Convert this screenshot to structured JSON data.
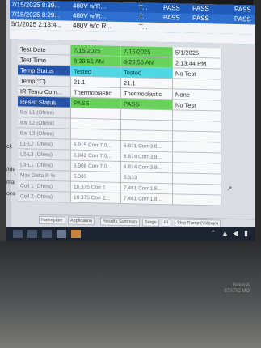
{
  "history": {
    "rows": [
      {
        "datetime": "7/15/2025 8:39...",
        "model": "480V w/R...",
        "col3": "T...",
        "status1": "PASS",
        "status2": "PASS",
        "status3": "PASS"
      },
      {
        "datetime": "7/15/2025 8:29...",
        "model": "480V w/R...",
        "col3": "T...",
        "status1": "PASS",
        "status2": "PASS",
        "status3": "PASS"
      },
      {
        "datetime": "5/1/2025 2:13:4...",
        "model": "480V w/o R...",
        "col3": "T...",
        "status1": "",
        "status2": "",
        "status3": ""
      }
    ]
  },
  "table": {
    "rows": [
      {
        "label": "Test Date",
        "v1": "7/15/2025",
        "v2": "7/15/2025",
        "v3": "5/1/2025"
      },
      {
        "label": "Test Time",
        "v1": "8:39:51 AM",
        "v2": "8:29:56 AM",
        "v3": "2:13:44 PM"
      },
      {
        "label": "Temp Status",
        "v1": "Tested",
        "v2": "Tested",
        "v3": "No Test"
      },
      {
        "label": "Temp(°C)",
        "v1": "21.1",
        "v2": "21.1",
        "v3": ""
      },
      {
        "label": "IR Temp Com...",
        "v1": "Thermoplastic",
        "v2": "Thermoplastic",
        "v3": "None"
      },
      {
        "label": "Resist Status",
        "v1": "PASS",
        "v2": "PASS",
        "v3": "No Test"
      },
      {
        "label": "Bal L1 (Ohms)",
        "v1": "",
        "v2": "",
        "v3": ""
      },
      {
        "label": "Bal L2 (Ohms)",
        "v1": "",
        "v2": "",
        "v3": ""
      },
      {
        "label": "Bal L3 (Ohms)",
        "v1": "",
        "v2": "",
        "v3": ""
      },
      {
        "label": "L1-L2 (Ohms)",
        "v1": "6.915 Corr 7.0...",
        "v2": "6.971 Corr 3.8...",
        "v3": ""
      },
      {
        "label": "L2-L3 (Ohms)",
        "v1": "6.942 Corr 7.0...",
        "v2": "6.874 Corr 3.8...",
        "v3": ""
      },
      {
        "label": "L3-L1 (Ohms)",
        "v1": "6.906 Corr 7.0...",
        "v2": "6.874 Corr 3.8...",
        "v3": ""
      },
      {
        "label": "Max Delta R %",
        "v1": "5.333",
        "v2": "5.333",
        "v3": ""
      },
      {
        "label": "Coil 1 (Ohms)",
        "v1": "10.375 Corr 1...",
        "v2": "7.461 Corr 1.8...",
        "v3": ""
      },
      {
        "label": "Coil 2 (Ohms)",
        "v1": "10.375 Corr 1...",
        "v2": "7.461 Corr 1.8...",
        "v3": ""
      }
    ]
  },
  "tabs": [
    "Nameplate",
    "Application",
    "Results Summary",
    "Surge",
    "PI",
    "Step Ramp (Voltage)"
  ],
  "left_labels": [
    "ck",
    "/ide",
    "ma",
    "ons"
  ],
  "plate_text": [
    "Baker A",
    "STATIC MO"
  ]
}
